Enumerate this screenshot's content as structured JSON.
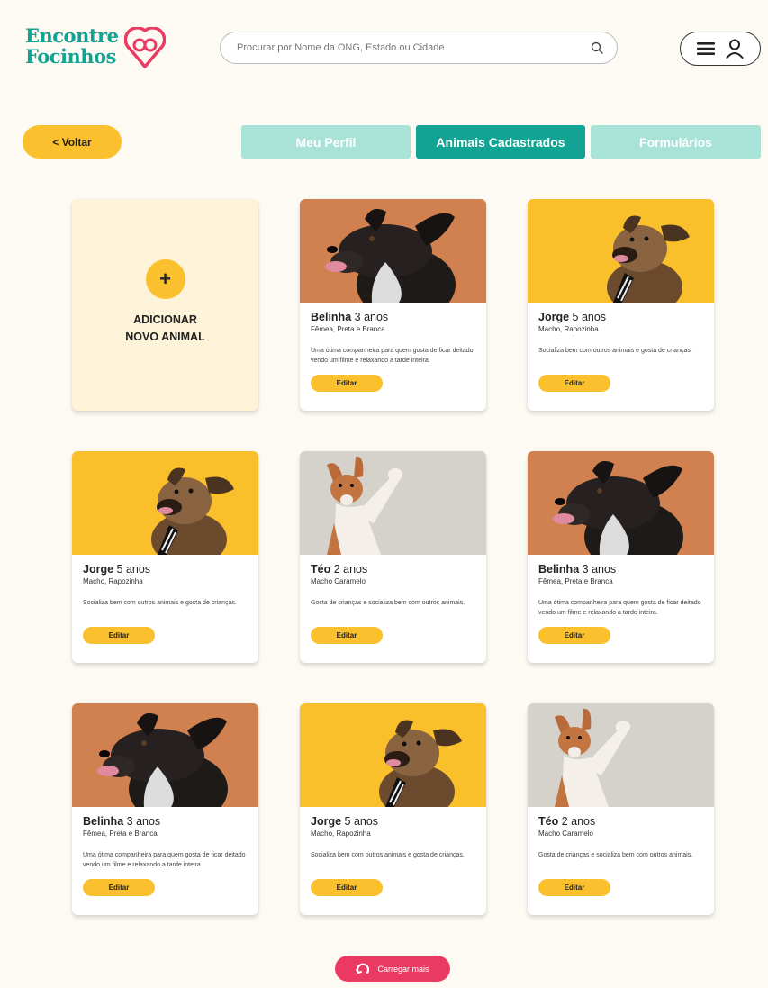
{
  "header": {
    "logo_line1": "Encontre",
    "logo_line2": "Focinhos",
    "search_placeholder": "Procurar por Nome da ONG, Estado ou Cidade"
  },
  "nav": {
    "back_label": "< Voltar",
    "tabs": [
      {
        "label": "Meu Perfil",
        "active": false
      },
      {
        "label": "Animais Cadastrados",
        "active": true
      },
      {
        "label": "Formulários",
        "active": false
      }
    ]
  },
  "add_card": {
    "icon": "+",
    "line1": "ADICIONAR",
    "line2": "NOVO ANIMAL"
  },
  "animals": [
    {
      "name": "Belinha",
      "age": "3 anos",
      "info": "Fêmea, Preta e Branca",
      "desc": "Uma ótima companheira para quem gosta de ficar deitado vendo um filme e relaxando a tarde inteira.",
      "edit_label": "Editar",
      "photo": "belinha"
    },
    {
      "name": "Jorge",
      "age": "5 anos",
      "info": "Macho, Rapozinha",
      "desc": "Socializa bem com outros animais e gosta de crianças.",
      "edit_label": "Editar",
      "photo": "jorge"
    },
    {
      "name": "Jorge",
      "age": "5 anos",
      "info": "Macho, Rapozinha",
      "desc": "Socializa bem com outros animais e gosta de crianças.",
      "edit_label": "Editar",
      "photo": "jorge"
    },
    {
      "name": "Téo",
      "age": "2 anos",
      "info": "Macho Caramelo",
      "desc": "Gosta de crianças e socializa bem com outros animais.",
      "edit_label": "Editar",
      "photo": "teo"
    },
    {
      "name": "Belinha",
      "age": "3 anos",
      "info": "Fêmea, Preta e Branca",
      "desc": "Uma ótima companheira para quem gosta de ficar deitado vendo um filme e relaxando a tarde inteira.",
      "edit_label": "Editar",
      "photo": "belinha"
    },
    {
      "name": "Belinha",
      "age": "3 anos",
      "info": "Fêmea, Preta e Branca",
      "desc": "Uma ótima companheira para quem gosta de ficar deitado vendo um filme e relaxando a tarde inteira.",
      "edit_label": "Editar",
      "photo": "belinha"
    },
    {
      "name": "Jorge",
      "age": "5 anos",
      "info": "Macho, Rapozinha",
      "desc": "Socializa bem com outros animais e gosta de crianças.",
      "edit_label": "Editar",
      "photo": "jorge"
    },
    {
      "name": "Téo",
      "age": "2 anos",
      "info": "Macho Caramelo",
      "desc": "Gosta de crianças e socializa bem com outros animais.",
      "edit_label": "Editar",
      "photo": "teo"
    }
  ],
  "load_more_label": "Carregar mais",
  "colors": {
    "brand_teal": "#13a395",
    "tab_inactive": "#a9e2d6",
    "accent_yellow": "#fbc02d",
    "load_more_red": "#ea3a61",
    "photo_orange": "#d0814f",
    "photo_yellow": "#f9c02c",
    "photo_grey": "#d5d1cb"
  },
  "icons": {
    "search": "search-icon",
    "menu": "hamburger-menu-icon",
    "user": "user-icon",
    "logo_pin": "location-pin-heart-icon",
    "load_more": "refresh-icon"
  }
}
